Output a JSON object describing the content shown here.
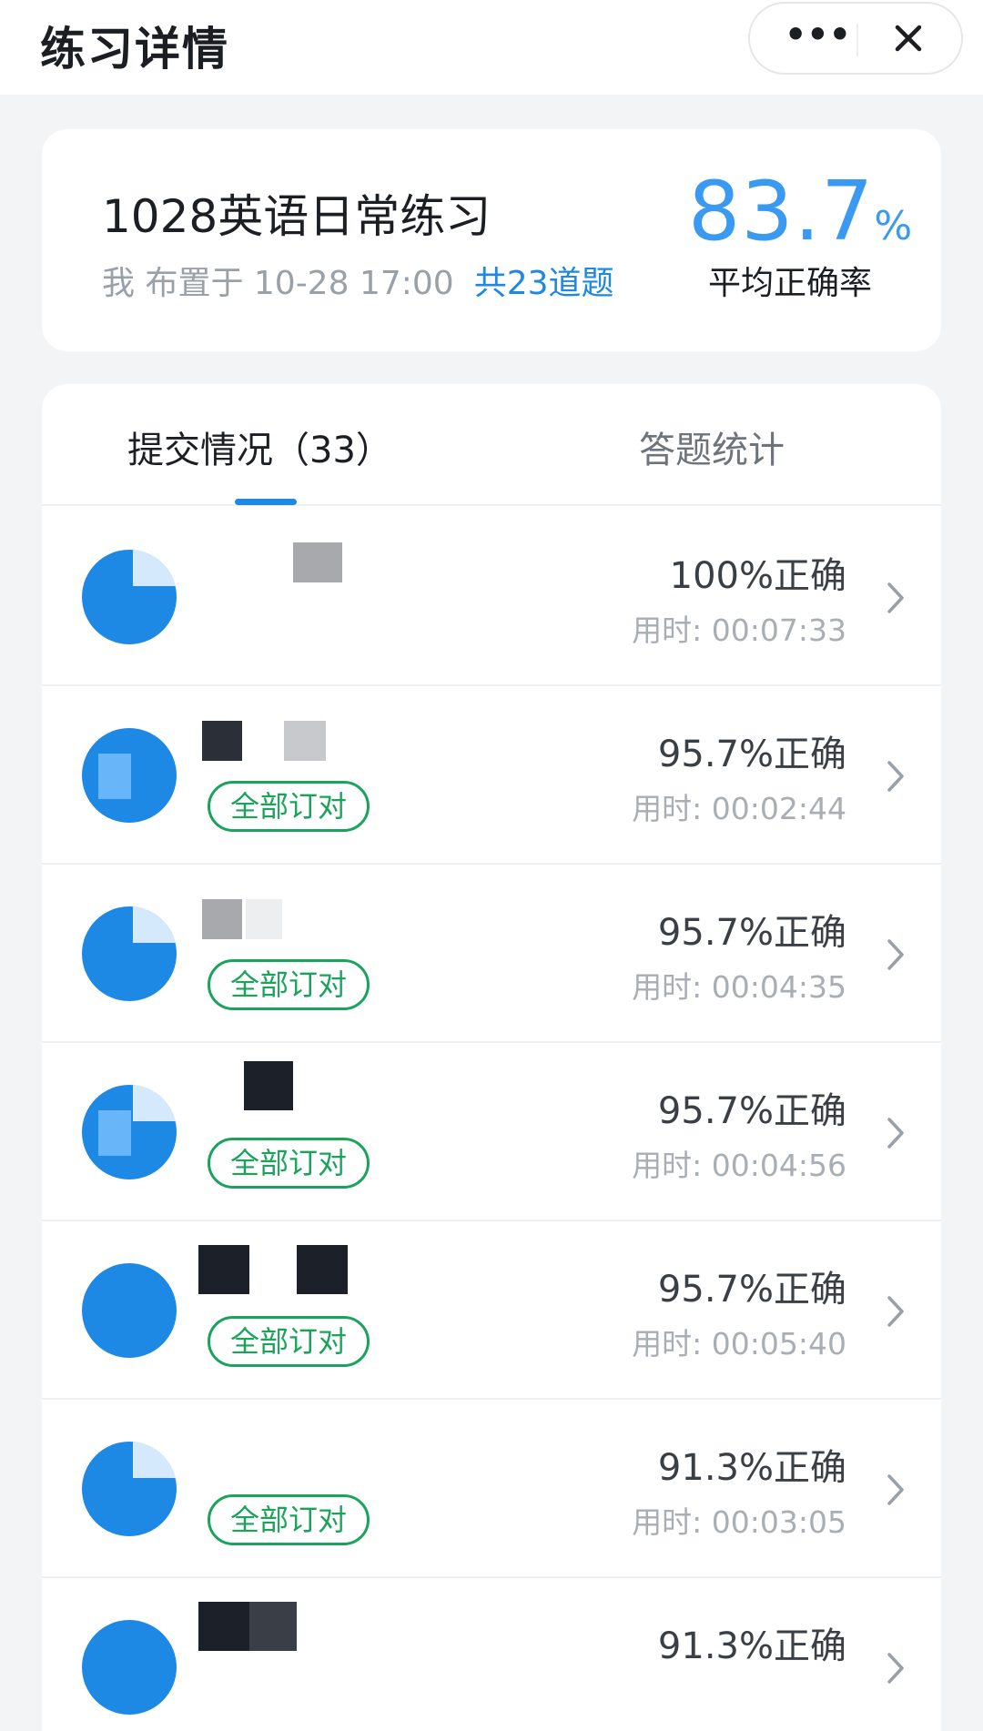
{
  "header": {
    "title": "练习详情",
    "more_icon": "more-dots-icon",
    "close_icon": "close-icon"
  },
  "summary": {
    "title": "1028英语日常练习",
    "meta": "我 布置于 10-28 17:00",
    "question_count": "共23道题",
    "average_rate_value": "83.7",
    "average_rate_unit": "%",
    "average_rate_label": "平均正确率"
  },
  "tabs": [
    {
      "label": "提交情况（33）",
      "active": true
    },
    {
      "label": "答题统计",
      "active": false
    }
  ],
  "colors": {
    "accent": "#1e88e5",
    "rate": "#3a9af2",
    "tag_green": "#1aa35a"
  },
  "submissions": [
    {
      "score": "100%正确",
      "time": "用时: 00:07:33",
      "tag": ""
    },
    {
      "score": "95.7%正确",
      "time": "用时: 00:02:44",
      "tag": "全部订对"
    },
    {
      "score": "95.7%正确",
      "time": "用时: 00:04:35",
      "tag": "全部订对"
    },
    {
      "score": "95.7%正确",
      "time": "用时: 00:04:56",
      "tag": "全部订对"
    },
    {
      "score": "95.7%正确",
      "time": "用时: 00:05:40",
      "tag": "全部订对"
    },
    {
      "score": "91.3%正确",
      "time": "用时: 00:03:05",
      "tag": "全部订对"
    },
    {
      "score": "91.3%正确",
      "time": "",
      "tag": ""
    }
  ]
}
